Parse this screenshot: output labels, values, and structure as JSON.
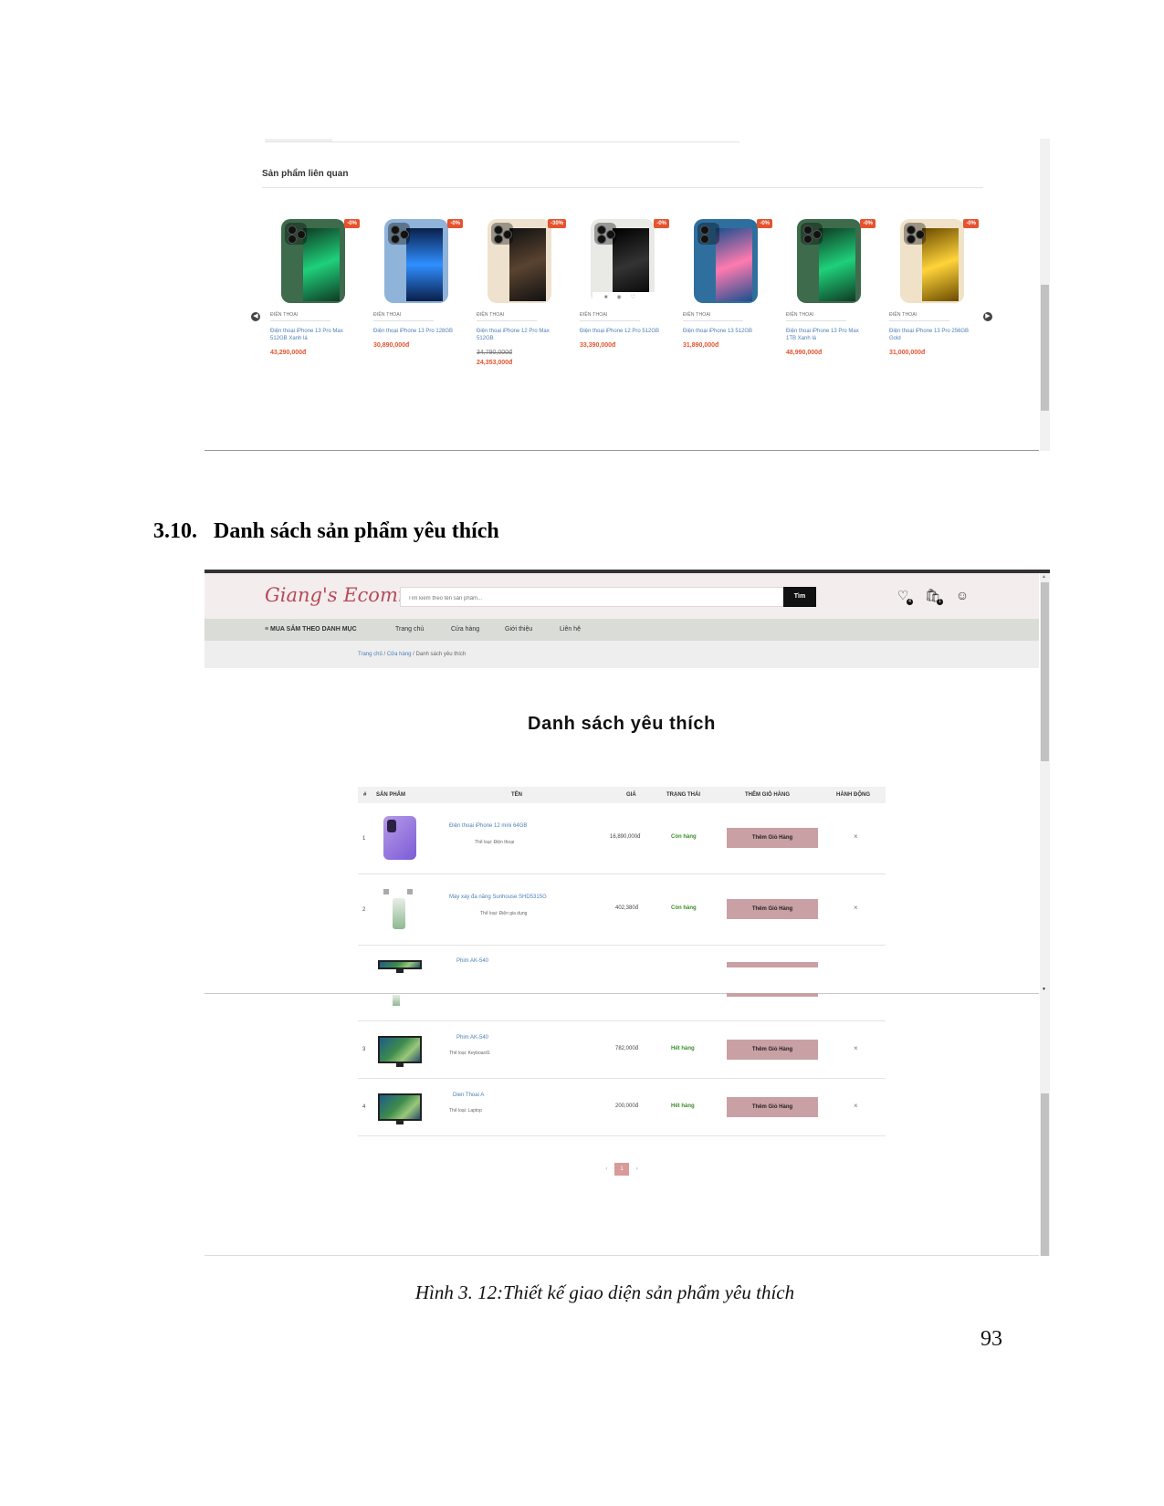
{
  "related": {
    "title": "Sản phẩm liên quan",
    "products": [
      {
        "category": "ĐIỆN THOẠI",
        "name": "Điện thoại iPhone 13 Pro Max 512GB Xanh lá",
        "price": "43,290,000đ",
        "badge": "-0%",
        "color": "#3d6b4c"
      },
      {
        "category": "ĐIỆN THOẠI",
        "name": "Điện thoại iPhone 13 Pro 128GB",
        "price": "30,890,000đ",
        "badge": "-0%",
        "color": "#8fb3d9"
      },
      {
        "category": "ĐIỆN THOẠI",
        "name": "Điện thoại iPhone 12 Pro Max 512GB",
        "old_price": "34,790,000đ",
        "price": "24,353,000đ",
        "badge": "-30%",
        "color": "#eee2cf"
      },
      {
        "category": "ĐIỆN THOẠI",
        "name": "Điện thoại iPhone 12 Pro 512GB",
        "price": "33,390,000đ",
        "badge": "-0%",
        "color": "#e9e9e6"
      },
      {
        "category": "ĐIỆN THOẠI",
        "name": "Điện thoại iPhone 13 512GB",
        "price": "31,890,000đ",
        "badge": "-0%",
        "color": "#2f6f9e"
      },
      {
        "category": "ĐIỆN THOẠI",
        "name": "Điện thoại iPhone 13 Pro Max 1TB Xanh lá",
        "price": "48,990,000đ",
        "badge": "-0%",
        "color": "#3d6b4c"
      },
      {
        "category": "ĐIỆN THOẠI",
        "name": "Điện thoại iPhone 13 Pro 256GB Gold",
        "price": "31,000,000đ",
        "badge": "-0%",
        "color": "#f0e2c8"
      }
    ]
  },
  "section": {
    "number": "3.10.",
    "title": "Danh sách sản phẩm yêu thích"
  },
  "site": {
    "logo": "Giang's Ecommerce",
    "search_placeholder": "Tìm kiếm theo tên sản phẩm...",
    "search_button": "Tìm",
    "wishlist_count": "4",
    "cart_count": "1",
    "nav": {
      "categories": "MUA SẮM THEO DANH MỤC",
      "home": "Trang chủ",
      "shop": "Cửa hàng",
      "about": "Giới thiệu",
      "contact": "Liên hệ"
    },
    "breadcrumb": {
      "home": "Trang chủ",
      "shop": "Cửa hàng",
      "current": "Danh sách yêu thích"
    }
  },
  "wishlist": {
    "title": "Danh sách yêu thích",
    "columns": [
      "#",
      "SẢN PHẨM",
      "TÊN",
      "GIÁ",
      "TRẠNG THÁI",
      "THÊM GIỎ HÀNG",
      "HÀNH ĐỘNG"
    ],
    "add_label": "Thêm Giỏ Hàng",
    "remove_label": "×",
    "rows": [
      {
        "index": "1",
        "name": "Điện thoại iPhone 12 mini 64GB",
        "type": "Thể loại: Điện thoại",
        "price": "16,890,000đ",
        "status": "Còn hàng"
      },
      {
        "index": "2",
        "name": "Máy xay đa năng Sunhouse SHD5315G",
        "type": "Thể loại: Điện gia dụng",
        "price": "402,380đ",
        "status": "Còn hàng"
      },
      {
        "index": "",
        "name": "Phim AK-540",
        "type": "",
        "price": "",
        "status": ""
      },
      {
        "index": "3",
        "name": "Phim AK-540",
        "type": "Thể loại: Keyboard1",
        "price": "782,000đ",
        "status": "Hết hàng"
      },
      {
        "index": "4",
        "name": "Dien Thoai A",
        "type": "Thể loại: Laptop",
        "price": "200,000đ",
        "status": "Hết hàng"
      }
    ],
    "pager": {
      "prev": "‹",
      "page": "1",
      "next": "›"
    }
  },
  "caption": "Hình 3. 12:Thiết kế giao diện sản phẩm yêu thích",
  "page_number": "93"
}
